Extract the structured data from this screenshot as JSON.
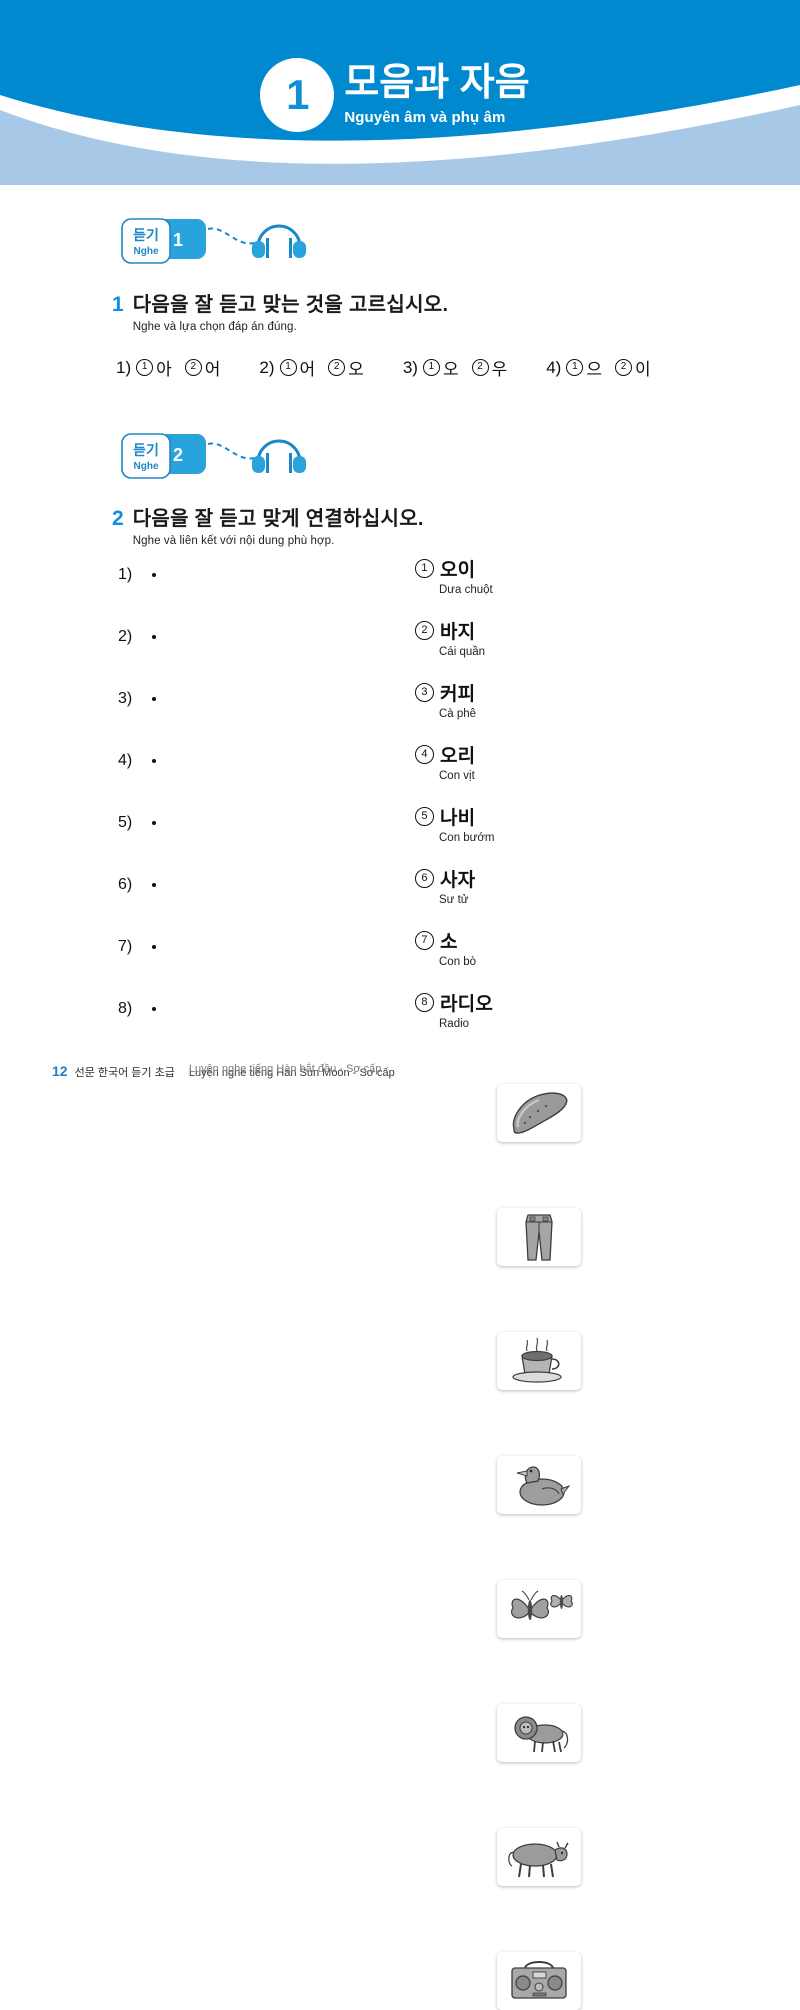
{
  "header": {
    "chapter_number": "1",
    "title_ko": "모음과 자음",
    "subtitle_vi": "Nguyên âm và phụ âm",
    "color_primary": "#0089CF",
    "color_secondary": "#A8C8E8"
  },
  "badges": [
    {
      "label_ko": "듣기",
      "label_vi": "Nghe",
      "track": "1",
      "icon": "headphones-icon"
    },
    {
      "label_ko": "듣기",
      "label_vi": "Nghe",
      "track": "2",
      "icon": "headphones-icon"
    }
  ],
  "questions": [
    {
      "number": "1",
      "text_ko": "다음을 잘 듣고 맞는 것을 고르십시오.",
      "text_vi": "Nghe và lựa chọn đáp án đúng."
    },
    {
      "number": "2",
      "text_ko": "다음을 잘 듣고 맞게 연결하십시오.",
      "text_vi": "Nghe và liên kết với nội dung phù hợp."
    }
  ],
  "q1_options": [
    {
      "label": "1)",
      "choices": [
        {
          "mark": "①",
          "word": "아"
        },
        {
          "mark": "②",
          "word": "어"
        }
      ]
    },
    {
      "label": "2)",
      "choices": [
        {
          "mark": "①",
          "word": "어"
        },
        {
          "mark": "②",
          "word": "오"
        }
      ]
    },
    {
      "label": "3)",
      "choices": [
        {
          "mark": "①",
          "word": "오"
        },
        {
          "mark": "②",
          "word": "우"
        }
      ]
    },
    {
      "label": "4)",
      "choices": [
        {
          "mark": "①",
          "word": "으"
        },
        {
          "mark": "②",
          "word": "이"
        }
      ]
    }
  ],
  "q2_left": [
    {
      "label": "1)"
    },
    {
      "label": "2)"
    },
    {
      "label": "3)"
    },
    {
      "label": "4)"
    },
    {
      "label": "5)"
    },
    {
      "label": "6)"
    },
    {
      "label": "7)"
    },
    {
      "label": "8)"
    }
  ],
  "q2_right": [
    {
      "mark": "①",
      "word_ko": "오이",
      "word_vi": "Dưa chuột",
      "image": "cucumber-image"
    },
    {
      "mark": "②",
      "word_ko": "바지",
      "word_vi": "Cái quần",
      "image": "pants-image"
    },
    {
      "mark": "③",
      "word_ko": "커피",
      "word_vi": "Cà phê",
      "image": "coffee-cup-image"
    },
    {
      "mark": "④",
      "word_ko": "오리",
      "word_vi": "Con vịt",
      "image": "duck-image"
    },
    {
      "mark": "⑤",
      "word_ko": "나비",
      "word_vi": "Con bướm",
      "image": "butterfly-image"
    },
    {
      "mark": "⑥",
      "word_ko": "사자",
      "word_vi": "Sư tử",
      "image": "lion-image"
    },
    {
      "mark": "⑦",
      "word_ko": "소",
      "word_vi": "Con bò",
      "image": "cow-image"
    },
    {
      "mark": "⑧",
      "word_ko": "라디오",
      "word_vi": "Radio",
      "image": "radio-image"
    }
  ],
  "footer": {
    "page_number": "12",
    "book_title_ko": "선문 한국어 듣기 초급",
    "book_title_vi": "Luyện nghe tiếng Hàn Sun Moon - Sơ cấp",
    "book_title_vi_overlay": "Luyện nghe tiếng Hàn bắt đầu - Sơ cấp"
  }
}
